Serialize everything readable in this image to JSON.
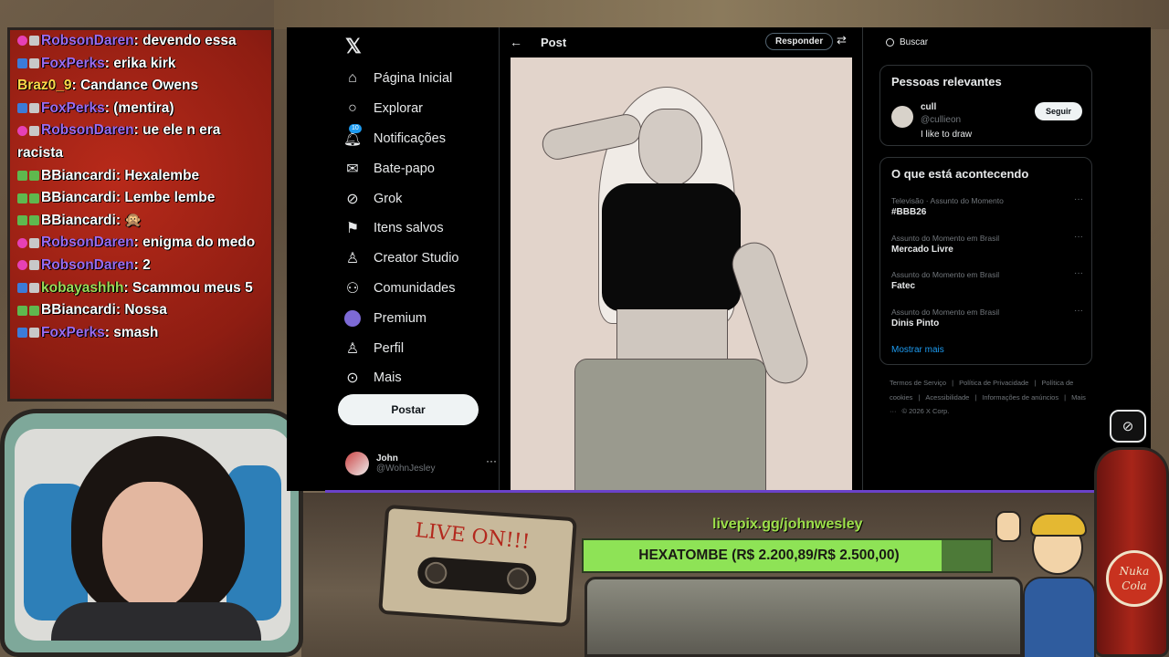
{
  "chat": {
    "messages": [
      {
        "user": "RobsonDaren",
        "badges": [
          "pink",
          "gray"
        ],
        "color": "purple",
        "text": "devendo essa"
      },
      {
        "user": "FoxPerks",
        "badges": [
          "blue",
          "gray"
        ],
        "color": "purple",
        "text": "erika kirk"
      },
      {
        "user": "Braz0_9",
        "badges": [],
        "color": "yellow",
        "text": "Candance Owens"
      },
      {
        "user": "FoxPerks",
        "badges": [
          "blue",
          "gray"
        ],
        "color": "purple",
        "text": "(mentira)"
      },
      {
        "user": "RobsonDaren",
        "badges": [
          "pink",
          "gray"
        ],
        "color": "purple",
        "text": "ue ele n era racista"
      },
      {
        "user": "BBiancardi",
        "badges": [
          "green",
          "green"
        ],
        "color": "white",
        "text": "Hexalembe"
      },
      {
        "user": "BBiancardi",
        "badges": [
          "green",
          "green"
        ],
        "color": "white",
        "text": "Lembe lembe"
      },
      {
        "user": "BBiancardi",
        "badges": [
          "green",
          "green"
        ],
        "color": "white",
        "text": "🙊"
      },
      {
        "user": "RobsonDaren",
        "badges": [
          "pink",
          "gray"
        ],
        "color": "purple",
        "text": "enigma do medo"
      },
      {
        "user": "RobsonDaren",
        "badges": [
          "pink",
          "gray"
        ],
        "color": "purple",
        "text": "2"
      },
      {
        "user": "kobayashhh",
        "badges": [
          "blue",
          "gray"
        ],
        "color": "green",
        "text": "Scammou meus 5"
      },
      {
        "user": "BBiancardi",
        "badges": [
          "green",
          "green"
        ],
        "color": "white",
        "text": "Nossa"
      },
      {
        "user": "FoxPerks",
        "badges": [
          "blue",
          "gray"
        ],
        "color": "purple",
        "text": "smash"
      }
    ]
  },
  "x": {
    "logo": "𝕏",
    "nav": [
      {
        "label": "Página Inicial",
        "icon": "home-icon"
      },
      {
        "label": "Explorar",
        "icon": "search-icon"
      },
      {
        "label": "Notificações",
        "icon": "bell-icon",
        "badge": "10"
      },
      {
        "label": "Bate-papo",
        "icon": "mail-icon"
      },
      {
        "label": "Grok",
        "icon": "grok-icon"
      },
      {
        "label": "Itens salvos",
        "icon": "bookmark-icon"
      },
      {
        "label": "Creator Studio",
        "icon": "creator-studio-icon"
      },
      {
        "label": "Comunidades",
        "icon": "communities-icon"
      },
      {
        "label": "Premium",
        "icon": "premium-icon"
      },
      {
        "label": "Perfil",
        "icon": "person-icon"
      },
      {
        "label": "Mais",
        "icon": "more-circle-icon"
      }
    ],
    "post_button": "Postar",
    "account": {
      "name": "John",
      "handle": "@WohnJesley",
      "more": "···"
    },
    "post_header": {
      "back": "←",
      "title": "Post",
      "reply": "Responder",
      "settings": "⇄"
    },
    "search": {
      "placeholder": "Buscar"
    },
    "relevant": {
      "title": "Pessoas relevantes",
      "person": {
        "name": "cull",
        "handle": "@cullieon",
        "bio": "I like to draw",
        "follow": "Seguir"
      }
    },
    "trends": {
      "title": "O que está acontecendo",
      "items": [
        {
          "context": "Televisão · Assunto do Momento",
          "name": "#BBB26"
        },
        {
          "context": "Assunto do Momento em Brasil",
          "name": "Mercado Livre"
        },
        {
          "context": "Assunto do Momento em Brasil",
          "name": "Fatec"
        },
        {
          "context": "Assunto do Momento em Brasil",
          "name": "Dinis Pinto"
        }
      ],
      "more_dots": "···",
      "show_more": "Mostrar mais"
    },
    "footer": {
      "links": [
        "Termos de Serviço",
        "|",
        "Política de Privacidade",
        "|",
        "Política de cookies",
        "|",
        "Acessibilidade",
        "|",
        "Informações de anúncios",
        "|",
        "Mais ···",
        "© 2026 X Corp."
      ]
    }
  },
  "overlay": {
    "tape_label": "LIVE ON!!!",
    "livepix": "livepix.gg/johnwesley",
    "goal": {
      "text": "HEXATOMBE (R$ 2.200,89/R$ 2.500,00)",
      "fraction": 0.88
    },
    "bottle_label": "Nuka Cola",
    "colors": {
      "accent_purple": "#6a42c9",
      "goal_green": "#8ee356",
      "x_blue": "#1d9bf0"
    }
  }
}
